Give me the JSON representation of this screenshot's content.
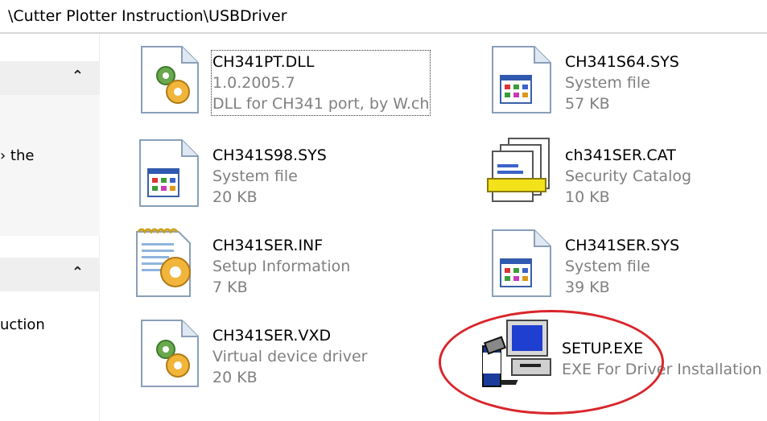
{
  "address_bar": {
    "path": "\\Cutter Plotter Instruction\\USBDriver"
  },
  "side_panel": {
    "sections": [
      {
        "chevron": "⌃",
        "text": "› the"
      },
      {
        "chevron": "⌃",
        "text": "uction"
      }
    ]
  },
  "files": [
    {
      "name": "CH341PT.DLL",
      "line2": "1.0.2005.7",
      "line3": "DLL for CH341 port, by W.ch",
      "icon": "dll-gear-icon",
      "selected": true
    },
    {
      "name": "CH341S64.SYS",
      "line2": "System file",
      "line3": "57 KB",
      "icon": "system-file-icon"
    },
    {
      "name": "CH341S98.SYS",
      "line2": "System file",
      "line3": "20 KB",
      "icon": "system-file-icon"
    },
    {
      "name": "ch341SER.CAT",
      "line2": "Security Catalog",
      "line3": "10 KB",
      "icon": "security-catalog-icon"
    },
    {
      "name": "CH341SER.INF",
      "line2": "Setup Information",
      "line3": "7 KB",
      "icon": "setup-information-icon"
    },
    {
      "name": "CH341SER.SYS",
      "line2": "System file",
      "line3": "39 KB",
      "icon": "system-file-icon"
    },
    {
      "name": "CH341SER.VXD",
      "line2": "Virtual device driver",
      "line3": "20 KB",
      "icon": "dll-gear-icon"
    },
    {
      "name": "SETUP.EXE",
      "line2": "EXE For Driver Installation",
      "icon": "setup-exe-icon"
    }
  ],
  "annotation": {
    "color": "#d9252b"
  }
}
